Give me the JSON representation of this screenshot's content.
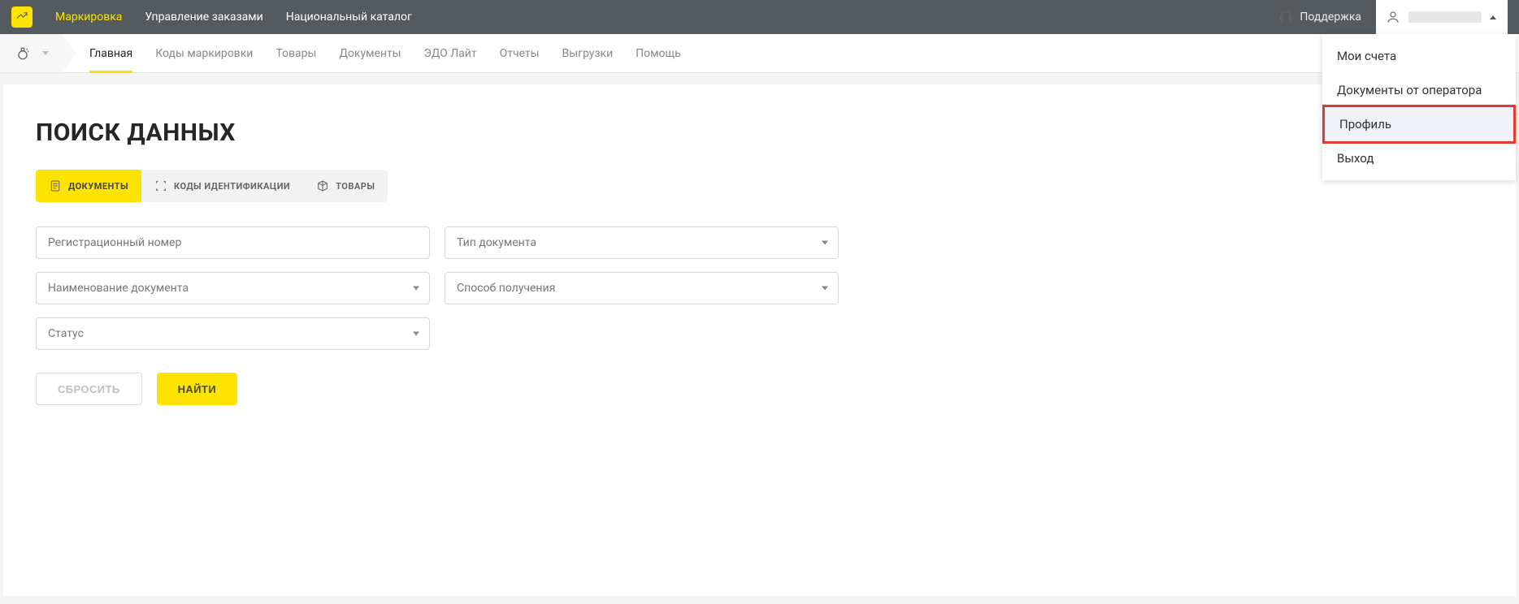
{
  "topnav": {
    "items": [
      "Маркировка",
      "Управление заказами",
      "Национальный каталог"
    ],
    "support_label": "Поддержка"
  },
  "user_menu": {
    "items": [
      "Мои счета",
      "Документы от оператора",
      "Профиль",
      "Выход"
    ],
    "highlight_index": 2
  },
  "subnav": {
    "items": [
      "Главная",
      "Коды маркировки",
      "Товары",
      "Документы",
      "ЭДО Лайт",
      "Отчеты",
      "Выгрузки",
      "Помощь"
    ],
    "active_index": 0
  },
  "page": {
    "title": "ПОИСК ДАННЫХ"
  },
  "pills": {
    "items": [
      "ДОКУМЕНТЫ",
      "КОДЫ ИДЕНТИФИКАЦИИ",
      "ТОВАРЫ"
    ],
    "active_index": 0
  },
  "fields": {
    "reg_number": "Регистрационный номер",
    "doc_type": "Тип документа",
    "doc_name": "Наименование документа",
    "recv_method": "Способ получения",
    "status": "Статус"
  },
  "buttons": {
    "reset": "СБРОСИТЬ",
    "find": "НАЙТИ"
  }
}
